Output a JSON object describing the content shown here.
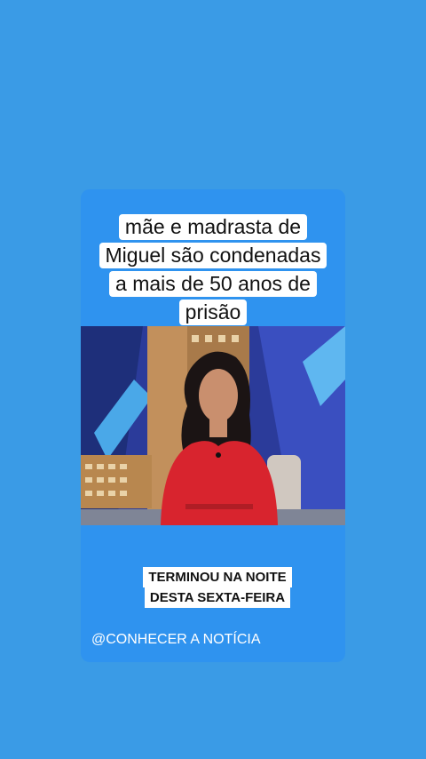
{
  "post": {
    "headline_lines": [
      "mãe e madrasta de",
      "Miguel são condenadas",
      "a mais de 50 anos de",
      "prisão"
    ],
    "subtitle_lines": [
      "TERMINOU NA NOITE",
      "DESTA SEXTA-FEIRA"
    ],
    "handle": "@CONHECER A NOTÍCIA"
  },
  "colors": {
    "background": "#3a9be6",
    "card": "#2f93ef",
    "text_box": "#ffffff",
    "presenter_dress": "#d8242e"
  }
}
